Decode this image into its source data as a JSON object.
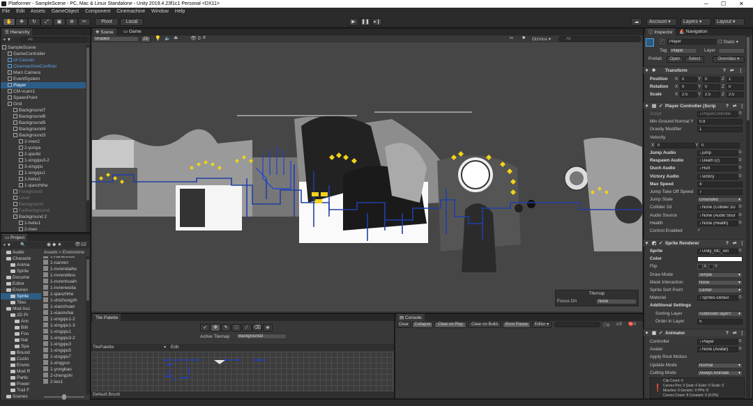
{
  "window": {
    "title": "Platformer - SampleScene - PC, Mac & Linux Standalone - Unity 2019.4.23f1c1 Personal <DX11>"
  },
  "menu": [
    "File",
    "Edit",
    "Assets",
    "GameObject",
    "Component",
    "Cinemachine",
    "Window",
    "Help"
  ],
  "toolbar": {
    "pivot": "Pivot",
    "local": "Local",
    "account": "Account",
    "layers": "Layers",
    "layout": "Layout"
  },
  "hierarchy": {
    "tab": "Hierarchy",
    "search_placeholder": "All",
    "items": [
      {
        "label": "SampleScene",
        "indent": 0,
        "type": "scene"
      },
      {
        "label": "GameController",
        "indent": 1
      },
      {
        "label": "UI Canvas",
        "indent": 1,
        "style": "blue"
      },
      {
        "label": "CinemachineConfiner",
        "indent": 1,
        "style": "blue"
      },
      {
        "label": "Main Camera",
        "indent": 1
      },
      {
        "label": "EventSystem",
        "indent": 1
      },
      {
        "label": "Player",
        "indent": 1,
        "style": "sel"
      },
      {
        "label": "CM vcam1",
        "indent": 1
      },
      {
        "label": "SpawnPoint",
        "indent": 1
      },
      {
        "label": "Grid",
        "indent": 1
      },
      {
        "label": "Background7",
        "indent": 2
      },
      {
        "label": "Background6",
        "indent": 2
      },
      {
        "label": "Background5",
        "indent": 2
      },
      {
        "label": "Background4",
        "indent": 2
      },
      {
        "label": "Background3",
        "indent": 2
      },
      {
        "label": "2-men2",
        "indent": 3
      },
      {
        "label": "2-yunya",
        "indent": 3
      },
      {
        "label": "2-qianbi",
        "indent": 3
      },
      {
        "label": "1-xingqiu3-2",
        "indent": 3
      },
      {
        "label": "3-xingqiu",
        "indent": 3
      },
      {
        "label": "1-xingqiu1",
        "indent": 3
      },
      {
        "label": "1-heliu2",
        "indent": 3
      },
      {
        "label": "1-qianzhihe",
        "indent": 3
      },
      {
        "label": "Foreground",
        "indent": 2,
        "style": "dim"
      },
      {
        "label": "Level",
        "indent": 2,
        "style": "dim"
      },
      {
        "label": "Background",
        "indent": 2,
        "style": "dim"
      },
      {
        "label": "FarBackground",
        "indent": 2,
        "style": "dim"
      },
      {
        "label": "Background 2",
        "indent": 2
      },
      {
        "label": "1-heliu1",
        "indent": 3
      },
      {
        "label": "2-men",
        "indent": 3
      }
    ]
  },
  "scene_view": {
    "tabs": [
      "Scene",
      "Game"
    ],
    "shading": "Shaded",
    "mode2d": "2D",
    "gizmos": "Gizmos",
    "search_placeholder": "All",
    "tilemap_overlay": {
      "title": "Tilemap",
      "focus_label": "Focus On",
      "focus_value": "None"
    }
  },
  "project": {
    "tab": "Project",
    "count": "10",
    "breadcrumb": "Assets > Environme",
    "folders": [
      {
        "label": "Audio",
        "indent": 1
      },
      {
        "label": "Characte",
        "indent": 1
      },
      {
        "label": "Anima",
        "indent": 2
      },
      {
        "label": "Sprite",
        "indent": 2
      },
      {
        "label": "Docume",
        "indent": 1
      },
      {
        "label": "Editor",
        "indent": 1
      },
      {
        "label": "Environ",
        "indent": 1
      },
      {
        "label": "Sprite",
        "indent": 2,
        "style": "sel"
      },
      {
        "label": "Tiles",
        "indent": 2
      },
      {
        "label": "Mod Ass",
        "indent": 1
      },
      {
        "label": "2D Pr",
        "indent": 2
      },
      {
        "label": "Anc",
        "indent": 3
      },
      {
        "label": "Billi",
        "indent": 3
      },
      {
        "label": "Foo",
        "indent": 3
      },
      {
        "label": "Nat",
        "indent": 3
      },
      {
        "label": "Spa",
        "indent": 3
      },
      {
        "label": "Bound",
        "indent": 2
      },
      {
        "label": "Custo",
        "indent": 2
      },
      {
        "label": "Enviro",
        "indent": 2
      },
      {
        "label": "Mod R",
        "indent": 2
      },
      {
        "label": "Partic",
        "indent": 2
      },
      {
        "label": "Power",
        "indent": 2
      },
      {
        "label": "Trail F",
        "indent": 2
      },
      {
        "label": "Scenes",
        "indent": 1
      }
    ],
    "files": [
      "1-haiseshuo",
      "1-nanren",
      "1-nvrendaihe",
      "1-nvrenditou",
      "1-nvrenhuaih",
      "1-nvrenwulia",
      "1-qianzhihe",
      "1-shizhongzh",
      "1-xiaochuan",
      "1-xiaonvhai",
      "1-xingqiu1-2",
      "1-xingqiu1-3",
      "1-xingqiu1",
      "1-xingqiu3-2",
      "1-xingqiu3",
      "1-xingqiu5",
      "1-xingqiu7",
      "1-xingyun",
      "1-yongbao",
      "2-chengshi",
      "2-leo1"
    ]
  },
  "tile_palette": {
    "tab": "Tile Palette",
    "active_tilemap_label": "Active Tilemap",
    "active_tilemap_value": "Background3",
    "palette_value": "TilePalette",
    "edit_label": "Edit",
    "brush_value": "Default Brush"
  },
  "console": {
    "tab": "Console",
    "buttons": [
      "Clear",
      "Collapse",
      "Clear on Play",
      "Clear on Build",
      "Error Pause",
      "Editor"
    ],
    "counts": [
      "0",
      "0",
      "0"
    ]
  },
  "inspector": {
    "tabs": [
      "Inspector",
      "Navigation"
    ],
    "object_name": "Player",
    "static_label": "Static",
    "tag_label": "Tag",
    "tag_value": "Player",
    "layer_label": "Layer",
    "layer_value": "",
    "prefab_label": "Prefab",
    "prefab_buttons": [
      "Open",
      "Select",
      "Overrides"
    ],
    "transform": {
      "title": "Transform",
      "position": {
        "label": "Position",
        "x": "0",
        "y": "0",
        "z": "1"
      },
      "rotation": {
        "label": "Rotation",
        "x": "0",
        "y": "0",
        "z": "0"
      },
      "scale": {
        "label": "Scale",
        "x": "2.5",
        "y": "2.5",
        "z": "2.5"
      }
    },
    "player_controller": {
      "title": "Player Controller (Scrip",
      "fields": [
        {
          "label": "Script",
          "value": "PlayerControlle",
          "kind": "obj",
          "dim": true
        },
        {
          "label": "Min Ground Normal Y",
          "value": "0.9",
          "kind": "num"
        },
        {
          "label": "Gravity Modifier",
          "value": "1",
          "kind": "num"
        },
        {
          "label": "Velocity",
          "value": "",
          "kind": "none"
        },
        {
          "label": "",
          "value": "",
          "kind": "xy",
          "x": "0",
          "y": "0"
        },
        {
          "label": "Jump Audio",
          "value": "jump",
          "kind": "obj",
          "bold": true
        },
        {
          "label": "Respawn Audio",
          "value": "Death (2)",
          "kind": "obj",
          "bold": true
        },
        {
          "label": "Ouch Audio",
          "value": "Hurt",
          "kind": "obj",
          "bold": true
        },
        {
          "label": "Victory Audio",
          "value": "victory",
          "kind": "obj",
          "bold": true
        },
        {
          "label": "Max Speed",
          "value": "4",
          "kind": "num",
          "bold": true
        },
        {
          "label": "Jump Take Off Speed",
          "value": "7",
          "kind": "num"
        },
        {
          "label": "Jump State",
          "value": "Grounded",
          "kind": "dd"
        },
        {
          "label": "Collider 2d",
          "value": "None (Collider 2D",
          "kind": "obj"
        },
        {
          "label": "Audio Source",
          "value": "None (Audio Sour",
          "kind": "obj"
        },
        {
          "label": "Health",
          "value": "None (Health)",
          "kind": "obj"
        },
        {
          "label": "Control Enabled",
          "value": "✓",
          "kind": "check"
        }
      ]
    },
    "sprite_renderer": {
      "title": "Sprite Renderer",
      "fields": [
        {
          "label": "Sprite",
          "value": "Unity_MC_ren",
          "kind": "obj",
          "bold": true
        },
        {
          "label": "Color",
          "value": "",
          "kind": "color",
          "bold": true
        },
        {
          "label": "Flip",
          "value": "",
          "kind": "flip",
          "x": "X",
          "y": "Y"
        },
        {
          "label": "Draw Mode",
          "value": "Simple",
          "kind": "dd"
        },
        {
          "label": "Mask Interaction",
          "value": "None",
          "kind": "dd"
        },
        {
          "label": "Sprite Sort Point",
          "value": "Center",
          "kind": "dd"
        },
        {
          "label": "Material",
          "value": "Sprites-Defaul",
          "kind": "obj"
        },
        {
          "label": "Additional Settings",
          "value": "",
          "kind": "header"
        },
        {
          "label": "Sorting Layer",
          "value": "<unknown layer>",
          "kind": "dd",
          "indent": true
        },
        {
          "label": "Order in Layer",
          "value": "5",
          "kind": "num",
          "indent": true
        }
      ]
    },
    "animator": {
      "title": "Animator",
      "fields": [
        {
          "label": "Controller",
          "value": "Player",
          "kind": "obj"
        },
        {
          "label": "Avatar",
          "value": "None (Avatar)",
          "kind": "obj"
        },
        {
          "label": "Apply Root Motion",
          "value": "",
          "kind": "check"
        },
        {
          "label": "Update Mode",
          "value": "Normal",
          "kind": "dd"
        },
        {
          "label": "Culling Mode",
          "value": "Always Animate",
          "kind": "dd"
        }
      ],
      "info": [
        "Clip Count: 6",
        "Curves Pos: 0 Quat: 0 Euler: 0 Scale: 0",
        "Muscles: 0 Generic: 0 PPtr: 8",
        "Curves Count: 8 Constant: 0 (0.0%)"
      ]
    }
  },
  "colors": {
    "selection": "#2c5d87",
    "scene_bg": "#464646",
    "panel_bg": "#383838",
    "gizmo_blue": "#1f3fa6",
    "coin_yellow": "#f2d21a"
  }
}
